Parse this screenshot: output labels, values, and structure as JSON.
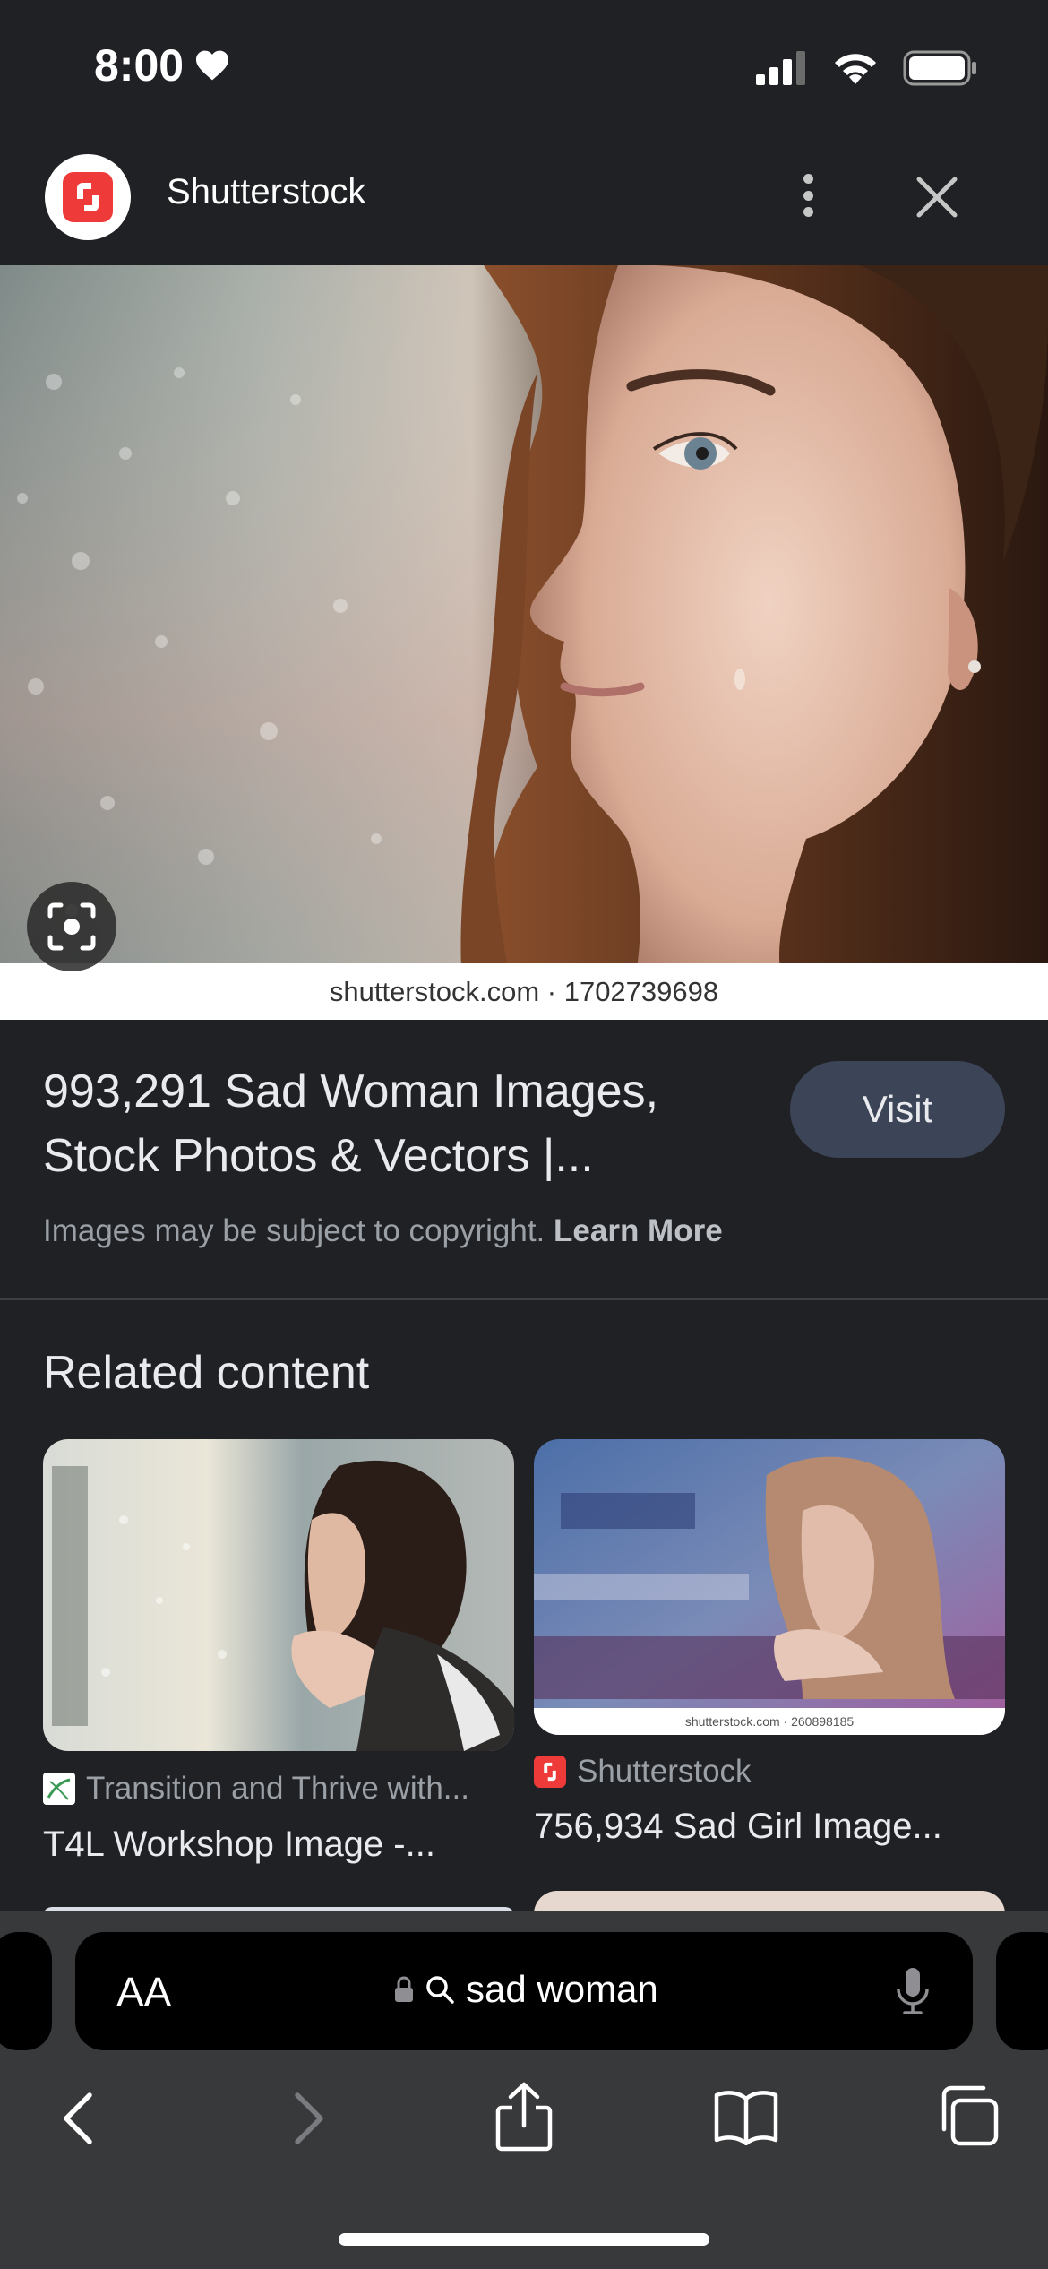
{
  "status": {
    "time": "8:00"
  },
  "header": {
    "source_name": "Shutterstock"
  },
  "main_image": {
    "watermark": "shutterstock.com · 1702739698"
  },
  "result": {
    "title_line1": "993,291 Sad Woman Images,",
    "title_line2": "Stock Photos & Vectors |...",
    "visit_label": "Visit",
    "copyright_text": "Images may be subject to copyright.",
    "learn_more": "Learn More"
  },
  "related": {
    "heading": "Related content",
    "cards": [
      {
        "source": "Transition and Thrive with...",
        "title": "T4L Workshop Image -..."
      },
      {
        "source": "Shutterstock",
        "title": "756,934 Sad Girl Image...",
        "watermark": "shutterstock.com · 260898185"
      }
    ]
  },
  "safari": {
    "aa_label": "AA",
    "address": "sad woman"
  },
  "icons": {
    "signal": "signal-bars-icon",
    "wifi": "wifi-icon",
    "battery": "battery-icon",
    "more": "more-vertical-icon",
    "close": "close-icon",
    "lens": "lens-icon",
    "lock": "lock-icon",
    "search": "search-icon",
    "mic": "mic-icon",
    "back": "chevron-left-icon",
    "forward": "chevron-right-icon",
    "share": "share-icon",
    "bookmarks": "book-icon",
    "tabs": "tabs-icon"
  }
}
